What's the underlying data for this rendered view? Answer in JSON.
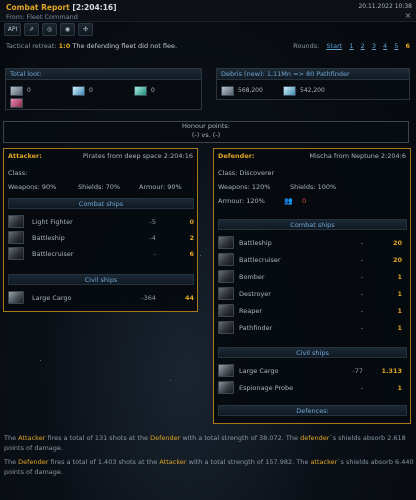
{
  "header": {
    "title": "Combat Report",
    "coord": "[2:204:16]",
    "from": "From: Fleet Command",
    "date": "20.11.2022 10:38",
    "close_icon": "×"
  },
  "toolbar": {
    "api": "API",
    "buttons": [
      {
        "icon": "share-icon",
        "glyph": "⇗"
      },
      {
        "icon": "target-icon",
        "glyph": "◎"
      },
      {
        "icon": "eye-icon",
        "glyph": "◉"
      },
      {
        "icon": "simulate-icon",
        "glyph": "✣"
      }
    ]
  },
  "retreat": {
    "label": "Tactical retreat:",
    "ratio": "1:0",
    "message": "The defending fleet did not flee."
  },
  "rounds": {
    "label": "Rounds:",
    "start": "Start",
    "items": [
      "1",
      "2",
      "3",
      "4",
      "5",
      "6"
    ],
    "active": "6"
  },
  "loot": {
    "title": "Total loot:",
    "items": [
      {
        "name": "metal",
        "value": "0",
        "color": "#8a9aa6"
      },
      {
        "name": "crystal",
        "value": "0",
        "color": "#7fc3e0"
      },
      {
        "name": "deuterium",
        "value": "0",
        "color": "#56c8b8"
      },
      {
        "name": "food",
        "value": "",
        "color": "#d04a7a"
      }
    ]
  },
  "debris": {
    "title": "Debris (new): 1,11Mn => 80 Pathfinder",
    "metal": "568,200",
    "crystal": "542,200"
  },
  "honour": {
    "title": "Honour points:",
    "value": "(-) vs. (-)"
  },
  "attacker": {
    "title": "Attacker:",
    "name": "Pirates from deep space 2:204:16",
    "class_label": "Class:",
    "class_value": "",
    "weapons": "Weapons: 90%",
    "shields": "Shields: 70%",
    "armour": "Armour: 90%",
    "combat_label": "Combat ships",
    "combat": [
      {
        "name": "Light Fighter",
        "lost": "-5",
        "left": "0"
      },
      {
        "name": "Battleship",
        "lost": "-4",
        "left": "2"
      },
      {
        "name": "Battlecruiser",
        "lost": "-",
        "left": "6"
      }
    ],
    "civil_label": "Civil ships",
    "civil": [
      {
        "name": "Large Cargo",
        "lost": "-364",
        "left": "44"
      }
    ]
  },
  "defender": {
    "title": "Defender:",
    "name": "Mischa from Neptune 2:204:6",
    "class_label": "Class:",
    "class_value": "Discoverer",
    "weapons": "Weapons: 120%",
    "shields": "Shields: 100%",
    "armour": "Armour: 120%",
    "lifeforms": "0",
    "combat_label": "Combat ships",
    "combat": [
      {
        "name": "Battleship",
        "lost": "-",
        "left": "20"
      },
      {
        "name": "Battlecruiser",
        "lost": "-",
        "left": "20"
      },
      {
        "name": "Bomber",
        "lost": "-",
        "left": "1"
      },
      {
        "name": "Destroyer",
        "lost": "-",
        "left": "1"
      },
      {
        "name": "Reaper",
        "lost": "-",
        "left": "1"
      },
      {
        "name": "Pathfinder",
        "lost": "-",
        "left": "1"
      }
    ],
    "civil_label": "Civil ships",
    "civil": [
      {
        "name": "Large Cargo",
        "lost": "-77",
        "left": "1.313"
      },
      {
        "name": "Espionage Probe",
        "lost": "-",
        "left": "1"
      }
    ],
    "defences_label": "Defences:"
  },
  "summary": {
    "line1_a": "The",
    "line1_att": "Attacker",
    "line1_b": "fires a total of 131 shots at the",
    "line1_def": "Defender",
    "line1_c": "with a total strength of 38.072. The",
    "line1_def2": "defender",
    "line1_d": "`s shields absorb",
    "line1_e": "2.618 points of damage.",
    "line2_a": "The",
    "line2_def": "Defender",
    "line2_b": "fires a total of 1.403 shots at the",
    "line2_att": "Attacker",
    "line2_c": "with a total strength of 157.982. The",
    "line2_att2": "attacker",
    "line2_d": "`s shields absorb",
    "line2_e": "6.440 points of damage."
  }
}
